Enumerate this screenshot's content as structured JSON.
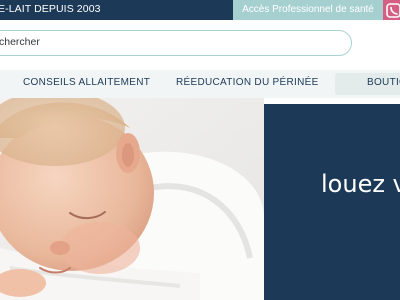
{
  "topbar": {
    "tagline": "E-LAIT DEPUIS 2003",
    "pro_access_label": "Accès Professionnel de santé",
    "pro_access_icon": "phone-icon"
  },
  "search": {
    "placeholder": "chercher"
  },
  "nav": {
    "items": [
      {
        "label": "CONSEILS ALLAITEMENT"
      },
      {
        "label": "RÉEDUCATION DU PÉRINÉE"
      },
      {
        "label": "BOUTIC"
      }
    ]
  },
  "hero": {
    "panel_text": "louez v"
  },
  "colors": {
    "navy": "#1c3a57",
    "teal": "#a6cfd0",
    "pink": "#d55e84",
    "nav_bg": "#f1f5f5"
  }
}
